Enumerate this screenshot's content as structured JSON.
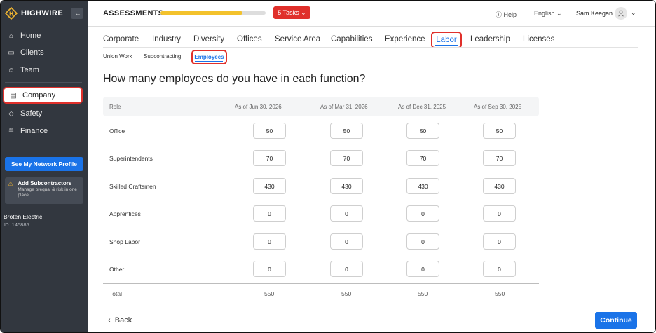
{
  "brand": {
    "name": "HIGHWIRE",
    "collapse_icon": "collapse-sidebar-icon"
  },
  "sidebar": {
    "items": [
      {
        "label": "Home",
        "icon": "home-icon"
      },
      {
        "label": "Clients",
        "icon": "clients-icon"
      },
      {
        "label": "Team",
        "icon": "team-icon"
      },
      {
        "label": "Company",
        "icon": "building-icon"
      },
      {
        "label": "Safety",
        "icon": "shield-icon"
      },
      {
        "label": "Finance",
        "icon": "chart-icon"
      }
    ],
    "network_button": "See My Network Profile",
    "add_subcontractors": {
      "title": "Add Subcontractors",
      "desc": "Manage prequal & risk in one place."
    },
    "org": {
      "name": "Broten Electric",
      "id": "ID: 145885"
    }
  },
  "header": {
    "title": "ASSESSMENTS",
    "progress_pct": 78,
    "tasks_badge": "5 Tasks",
    "help": "Help",
    "language": "English",
    "user_name": "Sam Keegan"
  },
  "tabs": [
    "Corporate",
    "Industry",
    "Diversity",
    "Offices",
    "Service Area",
    "Capabilities",
    "Experience",
    "Labor",
    "Leadership",
    "Licenses"
  ],
  "subtabs": [
    "Union Work",
    "Subcontracting",
    "Employees"
  ],
  "question": "How many employees do you have in each function?",
  "table": {
    "role_header": "Role",
    "columns": [
      "As of Jun 30, 2026",
      "As of Mar 31, 2026",
      "As of Dec 31, 2025",
      "As of Sep 30, 2025"
    ],
    "rows": [
      {
        "role": "Office",
        "values": [
          "50",
          "50",
          "50",
          "50"
        ]
      },
      {
        "role": "Superintendents",
        "values": [
          "70",
          "70",
          "70",
          "70"
        ]
      },
      {
        "role": "Skilled Craftsmen",
        "values": [
          "430",
          "430",
          "430",
          "430"
        ]
      },
      {
        "role": "Apprentices",
        "values": [
          "0",
          "0",
          "0",
          "0"
        ]
      },
      {
        "role": "Shop Labor",
        "values": [
          "0",
          "0",
          "0",
          "0"
        ]
      },
      {
        "role": "Other",
        "values": [
          "0",
          "0",
          "0",
          "0"
        ]
      }
    ],
    "total_label": "Total",
    "totals": [
      "550",
      "550",
      "550",
      "550"
    ]
  },
  "footer": {
    "back": "Back",
    "continue": "Continue"
  }
}
